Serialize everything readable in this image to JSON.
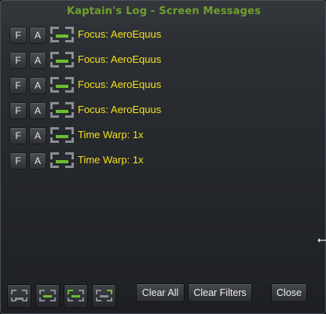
{
  "window": {
    "title": "Kaptain's Log - Screen Messages"
  },
  "messages": [
    {
      "f_label": "F",
      "a_label": "A",
      "text": "Focus: AeroEquus"
    },
    {
      "f_label": "F",
      "a_label": "A",
      "text": "Focus: AeroEquus"
    },
    {
      "f_label": "F",
      "a_label": "A",
      "text": "Focus: AeroEquus"
    },
    {
      "f_label": "F",
      "a_label": "A",
      "text": "Focus: AeroEquus"
    },
    {
      "f_label": "F",
      "a_label": "A",
      "text": "Time Warp: 1x"
    },
    {
      "f_label": "F",
      "a_label": "A",
      "text": "Time Warp: 1x"
    }
  ],
  "toolbar": {
    "clear_all": "Clear All",
    "clear_filters": "Clear Filters",
    "close": "Close",
    "tool_icons": [
      "position-bottom-icon",
      "position-center-icon",
      "position-top-left-icon",
      "position-top-right-icon"
    ]
  },
  "colors": {
    "title": "#6fa02d",
    "message": "#f3e01e",
    "icon_green": "#6cbf2e",
    "icon_gray": "#8a8d92"
  }
}
